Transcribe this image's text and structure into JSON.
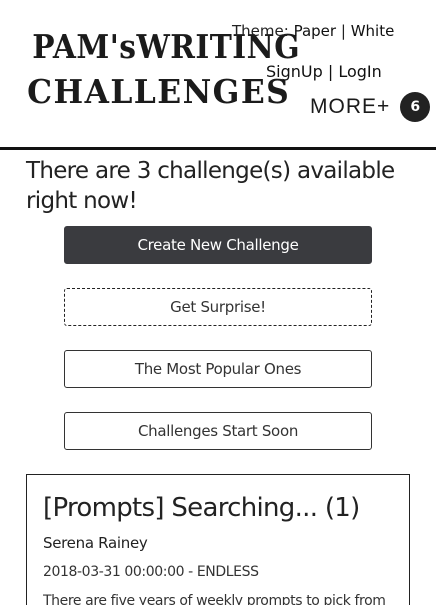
{
  "header": {
    "logo_line1": "PAM'sWRITING",
    "logo_line2": "CHALLENGES",
    "theme_label": "Theme:",
    "theme_option_paper": "Paper",
    "theme_separator": "|",
    "theme_option_white": "White",
    "signup": "SignUp",
    "auth_separator": "|",
    "login": "LogIn",
    "more_label": "MORE+",
    "more_count": "6"
  },
  "main": {
    "headline": "There are 3 challenge(s) available right now!",
    "buttons": {
      "create": "Create New Challenge",
      "surprise": "Get Surprise!",
      "popular": "The Most Popular Ones",
      "start_soon": "Challenges Start Soon"
    },
    "challenges": [
      {
        "title": "[Prompts] Searching... (1)",
        "author": "Serena Rainey",
        "date": "2018-03-31 00:00:00 - ENDLESS",
        "description": "There are five years of weekly prompts to pick from"
      }
    ]
  }
}
